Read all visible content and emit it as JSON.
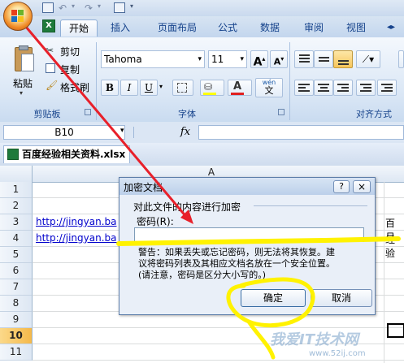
{
  "ribbon": {
    "tabs": [
      "开始",
      "插入",
      "页面布局",
      "公式",
      "数据",
      "审阅",
      "视图"
    ],
    "clipboard": {
      "paste": "粘贴",
      "cut": "剪切",
      "copy": "复制",
      "format_painter": "格式刷",
      "label": "剪贴板"
    },
    "font": {
      "name": "Tahoma",
      "size": "11",
      "label": "字体",
      "bold": "B",
      "italic": "I",
      "underline": "U",
      "grow": "A",
      "shrink": "A",
      "color_a": "A",
      "wen": "wén",
      "wen_cn": "文"
    },
    "alignment": {
      "label": "对齐方式"
    }
  },
  "formula_bar": {
    "name_box": "B10",
    "fx": "fx"
  },
  "workbook": {
    "filename": "百度经验相关资料.xlsx"
  },
  "grid": {
    "col_a": "A",
    "rows": [
      "1",
      "2",
      "3",
      "4",
      "5",
      "6",
      "7",
      "8",
      "9",
      "10",
      "11"
    ],
    "row3_link": "http://jingyan.ba",
    "row4_link": "http://jingyan.ba",
    "row3_right": "百月",
    "row4_right": "经验"
  },
  "dialog": {
    "title": "加密文档",
    "heading": "对此文件的内容进行加密",
    "password_label": "密码(R):",
    "note1": "警告：如果丢失或忘记密码，则无法将其恢复。建",
    "note2": "议将密码列表及其相应文档名放在一个安全位置。",
    "note3": "(请注意，密码是区分大小写的。)",
    "ok": "确定",
    "cancel": "取消",
    "help": "?",
    "close": "×"
  },
  "watermark": {
    "text": "我爱IT技术网",
    "url": "www.52ij.com"
  },
  "colors": {
    "annotation_red": "#e8202a",
    "annotation_yellow": "#fff200",
    "link_blue": "#0000cc"
  }
}
